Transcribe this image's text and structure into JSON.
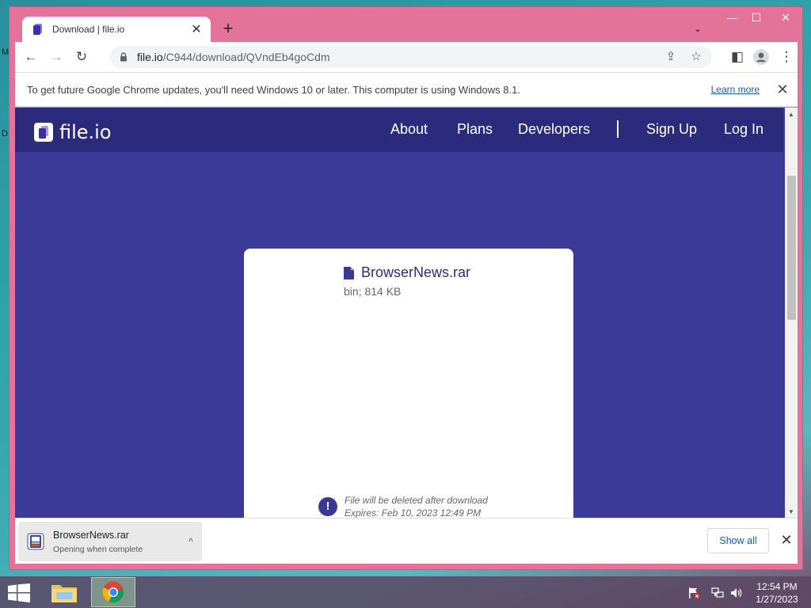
{
  "desktop": {
    "edge_labels": [
      "M",
      "D"
    ]
  },
  "browser": {
    "tab": {
      "title": "Download | file.io",
      "close_glyph": "✕"
    },
    "new_tab_glyph": "+",
    "tab_search_glyph": "⌄",
    "window_controls": {
      "minimize": "—",
      "maximize": "☐",
      "close": "✕"
    },
    "toolbar": {
      "back_glyph": "←",
      "forward_glyph": "→",
      "reload_glyph": "↻",
      "url_host": "file.io",
      "url_path": "/C944/download/QVndEb4goCdm",
      "share_glyph": "⇪",
      "bookmark_glyph": "☆",
      "sidepanel_glyph": "◧",
      "menu_glyph": "⋮"
    },
    "infobar": {
      "message": "To get future Google Chrome updates, you'll need Windows 10 or later. This computer is using Windows 8.1.",
      "learn_more": "Learn more",
      "close_glyph": "✕"
    }
  },
  "site": {
    "logo_text": "file.io",
    "nav": [
      "About",
      "Plans",
      "Developers",
      "Sign Up",
      "Log In"
    ],
    "file": {
      "name": "BrowserNews.rar",
      "meta": "bin; 814 KB"
    },
    "notice": {
      "icon": "!",
      "line1": "File will be deleted after download",
      "line2": "Expires: Feb 10, 2023 12:49 PM"
    }
  },
  "download_shelf": {
    "item": {
      "name": "BrowserNews.rar",
      "status": "Opening when complete",
      "menu_glyph": "^"
    },
    "show_all": "Show all",
    "close_glyph": "✕"
  },
  "taskbar": {
    "time": "12:54 PM",
    "date": "1/27/2023"
  },
  "colors": {
    "titlebar": "#e4739a",
    "site_nav": "#2b2a7c",
    "site_bg": "#3c3a98",
    "accent_link": "#1a56c2"
  }
}
